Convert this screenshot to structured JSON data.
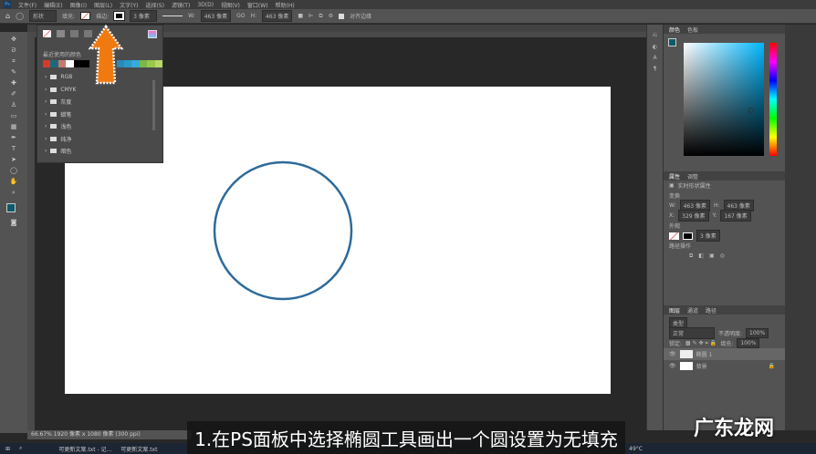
{
  "menu": [
    "文件(F)",
    "编辑(E)",
    "图像(I)",
    "图层(L)",
    "文字(Y)",
    "选择(S)",
    "滤镜(T)",
    "3D(D)",
    "视图(V)",
    "窗口(W)",
    "帮助(H)"
  ],
  "options": {
    "mode": "形状",
    "fill_label": "填充:",
    "stroke_label": "描边:",
    "stroke_width": "3 像素",
    "w_label": "W:",
    "w": "463 像素",
    "go": "GO",
    "h_label": "H:",
    "h": "463 像素",
    "align_edges": "对齐边缘"
  },
  "swatches": {
    "recent_label": "最近使用的颜色",
    "colors": [
      "#d83a2a",
      "#1a6a7a",
      "#c87a6a",
      "#ffffff",
      "#000000",
      "#000000",
      "#2a8ab8",
      "#2a9ac8",
      "#3aaad8",
      "#7ab84a",
      "#9ac84a",
      "#b8d86a"
    ],
    "folders": [
      "RGB",
      "CMYK",
      "灰度",
      "蜡笔",
      "浅色",
      "纯净",
      "暗色"
    ]
  },
  "color_panel": {
    "tabs": [
      "颜色",
      "色板"
    ],
    "fg": "#0e5a6a"
  },
  "properties": {
    "tabs": [
      "属性",
      "调整"
    ],
    "title": "实时形状属性",
    "transform": "变换",
    "w_label": "W:",
    "w": "463 像素",
    "h_label": "H:",
    "h": "463 像素",
    "x_label": "X:",
    "x": "329 像素",
    "y_label": "Y:",
    "y": "167 像素",
    "appearance": "外观",
    "stroke_width": "3 像素",
    "path_ops": "路径操作"
  },
  "layers": {
    "tabs": [
      "图层",
      "通道",
      "路径"
    ],
    "filter": "类型",
    "blend": "正常",
    "opacity_label": "不透明度:",
    "opacity": "100%",
    "lock_label": "锁定:",
    "fill_label": "填充:",
    "fill": "100%",
    "items": [
      "椭圆 1",
      "背景"
    ]
  },
  "status": "66.67%   1920 像素 x 1080 像素 (300 ppi)",
  "caption": "1.在PS面板中选择椭圆工具画出一个圆设置为无填充",
  "watermark": "广东龙网",
  "taskbar": {
    "items": [
      "可更新文案.txt - 记...",
      "可更新文案.txt"
    ],
    "temp": "49°C"
  }
}
